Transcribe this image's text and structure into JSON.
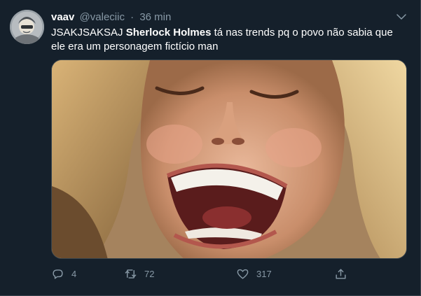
{
  "tweet": {
    "author": {
      "display_name": "vaav",
      "handle": "@valeciic"
    },
    "separator": "·",
    "time": "36 min",
    "text_before": "JSAKJSAKSAJ ",
    "text_bold": "Sherlock Holmes",
    "text_after": " tá nas trends pq o povo não sabia que ele era um personagem fictício man",
    "media": {
      "kind": "photo",
      "subject": "laughing woman with blonde hair"
    },
    "actions": {
      "reply_count": "4",
      "retweet_count": "72",
      "like_count": "317"
    },
    "icons": {
      "more": "chevron-down-icon",
      "reply": "reply-icon",
      "retweet": "retweet-icon",
      "like": "heart-icon",
      "share": "share-icon"
    }
  },
  "colors": {
    "background": "#15202b",
    "primary_text": "#ffffff",
    "secondary_text": "#8899a6",
    "border": "#38444d"
  }
}
